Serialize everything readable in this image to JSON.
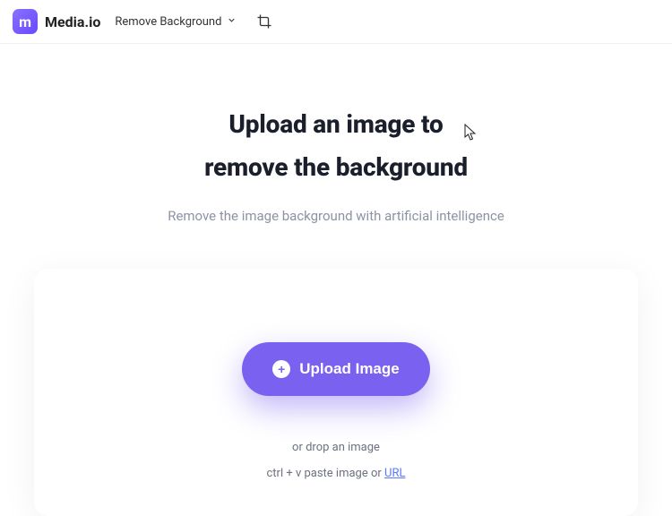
{
  "header": {
    "logo_letter": "m",
    "brand": "Media.io",
    "tool_label": "Remove Background"
  },
  "hero": {
    "title_line1": "Upload an image to",
    "title_line2": "remove the background",
    "subtitle": "Remove the image background  with artificial intelligence"
  },
  "upload": {
    "button_label": "Upload Image",
    "drop_hint": "or drop an image",
    "paste_prefix": "ctrl + v paste image or ",
    "url_label": "URL"
  }
}
